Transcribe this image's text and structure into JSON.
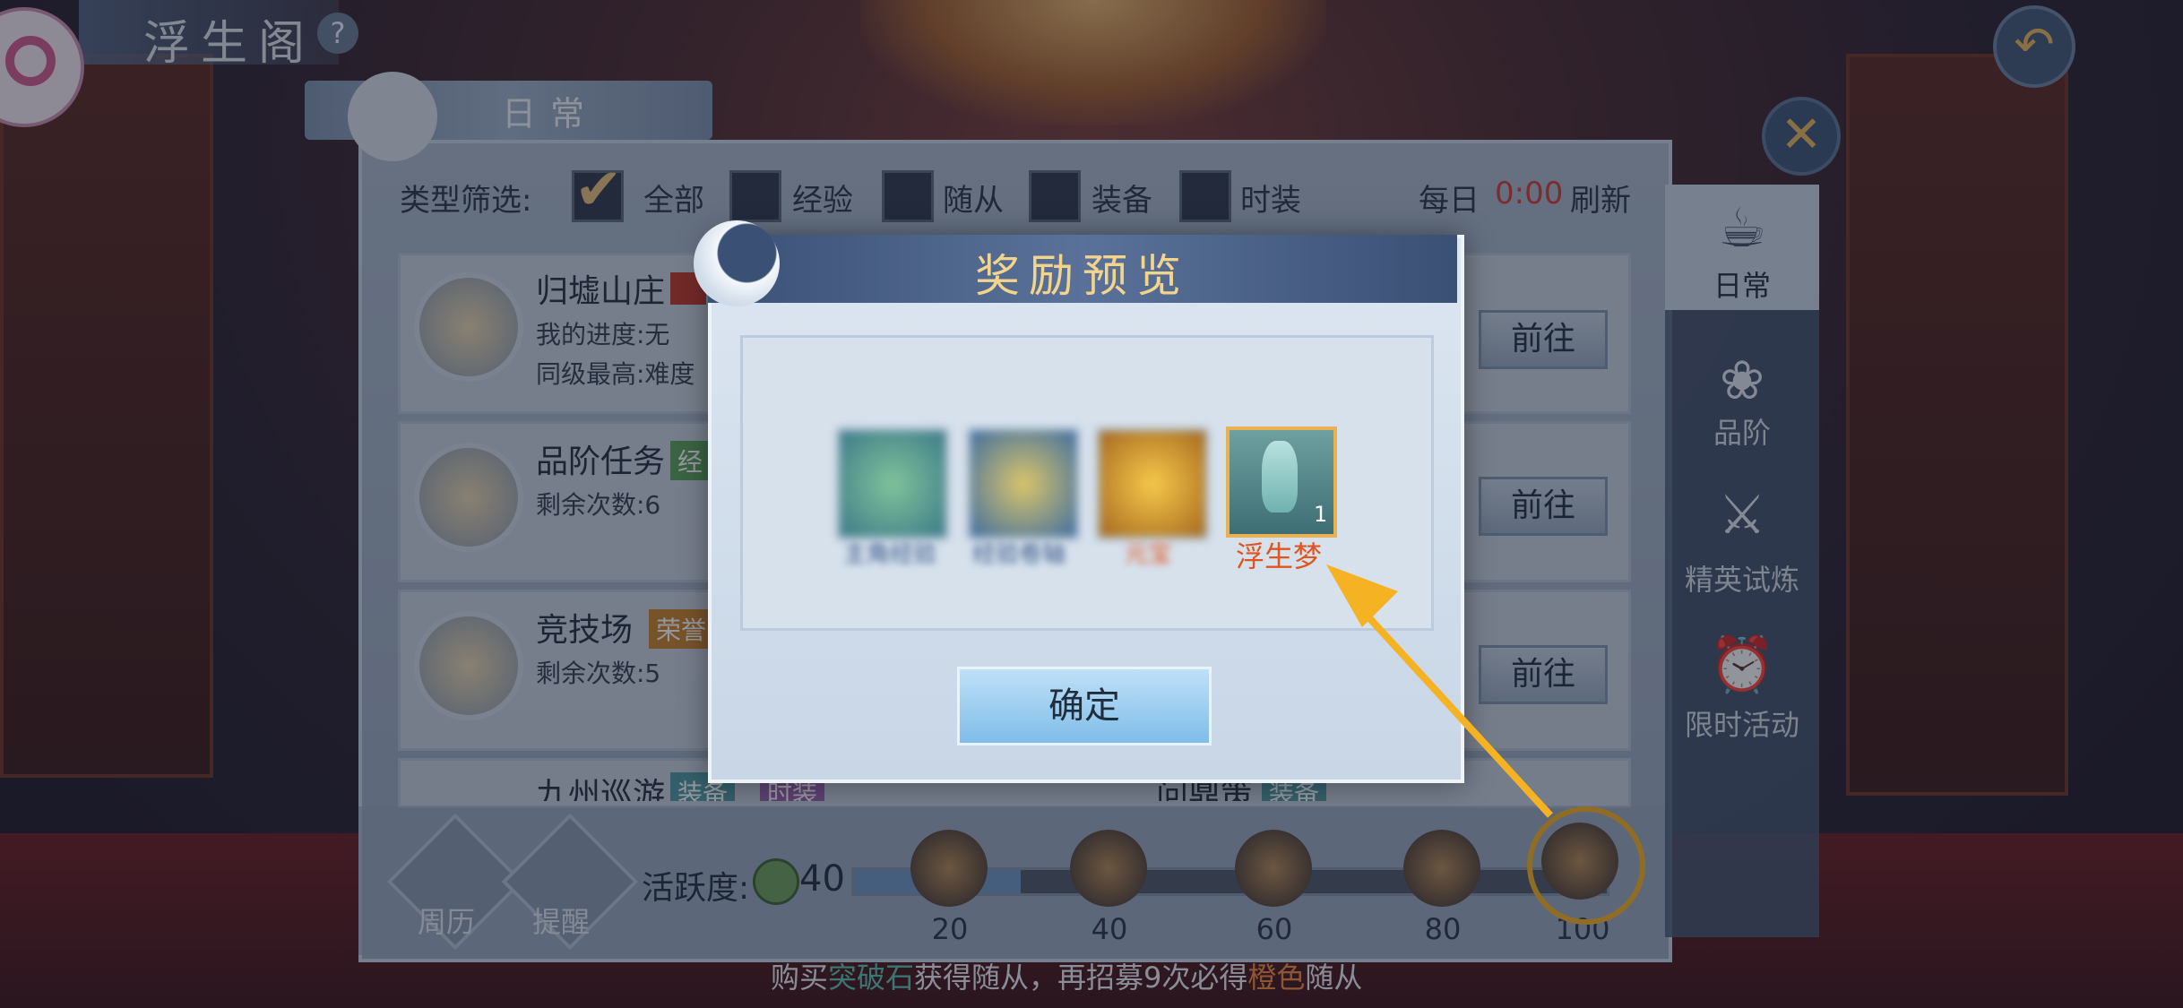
{
  "header": {
    "title": "浮生阁",
    "help_icon": "?",
    "tab_ribbon": "日常"
  },
  "top_right": {
    "back_icon": "back-arrow-icon",
    "close_icon": "close-icon"
  },
  "filter": {
    "label": "类型筛选:",
    "options": [
      {
        "label": "全部",
        "checked": true
      },
      {
        "label": "经验",
        "checked": false
      },
      {
        "label": "随从",
        "checked": false
      },
      {
        "label": "装备",
        "checked": false
      },
      {
        "label": "时装",
        "checked": false
      }
    ],
    "daily_label": "每日",
    "daily_time": "0:00",
    "daily_refresh": "刷新"
  },
  "activities": [
    {
      "name": "归墟山庄",
      "sub1": "我的进度:无",
      "sub2": "同级最高:难度",
      "go": "前往"
    },
    {
      "name": "品阶任务",
      "tag": "经",
      "sub1": "剩余次数:6",
      "go": "前往"
    },
    {
      "name": "竞技场",
      "tag": "荣誉",
      "sub1": "剩余次数:5",
      "go": "前往"
    },
    {
      "name": "九州巡游",
      "tag": "装备",
      "tag2": "时装",
      "right_name": "问鼎策",
      "right_tag": "装备"
    }
  ],
  "side_tabs": [
    {
      "label": "日常",
      "icon": "teapot-icon",
      "active": true
    },
    {
      "label": "品阶",
      "icon": "fan-icon",
      "active": false
    },
    {
      "label": "精英试炼",
      "icon": "sword-icon",
      "active": false
    },
    {
      "label": "限时活动",
      "icon": "alarm-clock-icon",
      "active": false
    }
  ],
  "bottom": {
    "weekly_label": "周历",
    "remind_label": "提醒",
    "activity_label": "活跃度:",
    "activity_value": "40",
    "activity_progress": 0.4,
    "chests": [
      "20",
      "40",
      "60",
      "80",
      "100"
    ],
    "tip_prefix": "购买",
    "tip_green": "突破石",
    "tip_mid": "获得随从，再招募9次必得",
    "tip_orange": "橙色",
    "tip_suffix": "随从"
  },
  "modal": {
    "title": "奖励预览",
    "items": [
      {
        "label": "主角经验",
        "icon": "jade-orb-icon"
      },
      {
        "label": "经验卷轴",
        "icon": "scroll-icon"
      },
      {
        "label": "元宝",
        "icon": "gold-ingot-icon"
      }
    ],
    "featured_item": {
      "label": "浮生梦",
      "count": "1",
      "icon": "vase-icon"
    },
    "confirm": "确定"
  },
  "colors": {
    "accent_red": "#d23b35",
    "highlight": "#f5b222",
    "featured_label": "#e0541f"
  }
}
